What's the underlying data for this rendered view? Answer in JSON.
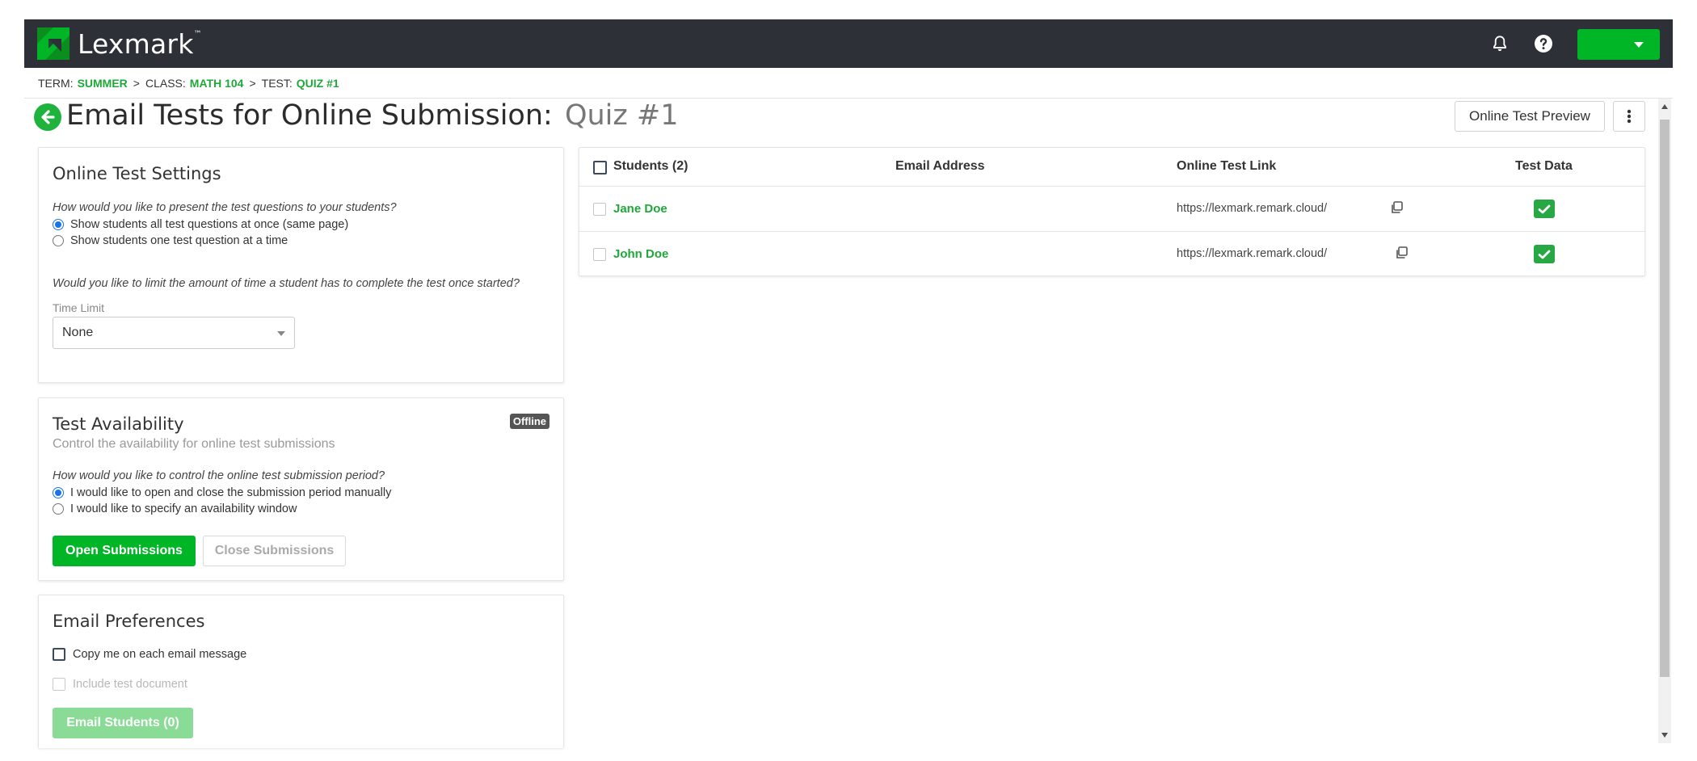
{
  "header": {
    "brand": "Lexmark",
    "brand_mark": "™",
    "icons": {
      "notifications": "bell-icon",
      "help": "question-circle-icon",
      "user_menu": "chevron-down-icon"
    },
    "accent_color": "#00b626",
    "bar_color": "#2e3038"
  },
  "breadcrumb": {
    "term_label": "TERM:",
    "term_value": "SUMMER",
    "class_label": "CLASS:",
    "class_value": "MATH 104",
    "test_label": "TEST:",
    "test_value": "QUIZ #1",
    "separator": ">"
  },
  "page": {
    "title": "Email Tests for Online Submission:",
    "subtitle": "Quiz #1",
    "preview_button": "Online Test Preview",
    "more_icon": "kebab-vertical-icon",
    "back_icon": "arrow-left-circle-icon"
  },
  "settings": {
    "title": "Online Test Settings",
    "question1": "How would you like to present the test questions to your students?",
    "options1": [
      {
        "label": "Show students all test questions at once (same page)",
        "selected": true
      },
      {
        "label": "Show students one test question at a time",
        "selected": false
      }
    ],
    "question2": "Would you like to limit the amount of time a student has to complete the test once started?",
    "time_limit_label": "Time Limit",
    "time_limit_value": "None"
  },
  "availability": {
    "title": "Test Availability",
    "subtitle": "Control the availability for online test submissions",
    "status_badge": "Offline",
    "question": "How would you like to control the online test submission period?",
    "options": [
      {
        "label": "I would like to open and close the submission period manually",
        "selected": true
      },
      {
        "label": "I would like to specify an availability window",
        "selected": false
      }
    ],
    "open_button": "Open Submissions",
    "close_button": "Close Submissions"
  },
  "email": {
    "title": "Email Preferences",
    "copy_me_label": "Copy me on each email message",
    "include_doc_label": "Include test document",
    "send_button": "Email Students (0)"
  },
  "table": {
    "headers": {
      "students": "Students (2)",
      "email": "Email Address",
      "link": "Online Test Link",
      "data": "Test Data"
    },
    "rows": [
      {
        "name": "Jane Doe",
        "email": "",
        "link": "https://lexmark.remark.cloud/",
        "test_data": true
      },
      {
        "name": "John Doe",
        "email": "",
        "link": "https://lexmark.remark.cloud/",
        "test_data": true
      }
    ],
    "icons": {
      "copy": "copy-icon",
      "check": "check-icon"
    }
  }
}
